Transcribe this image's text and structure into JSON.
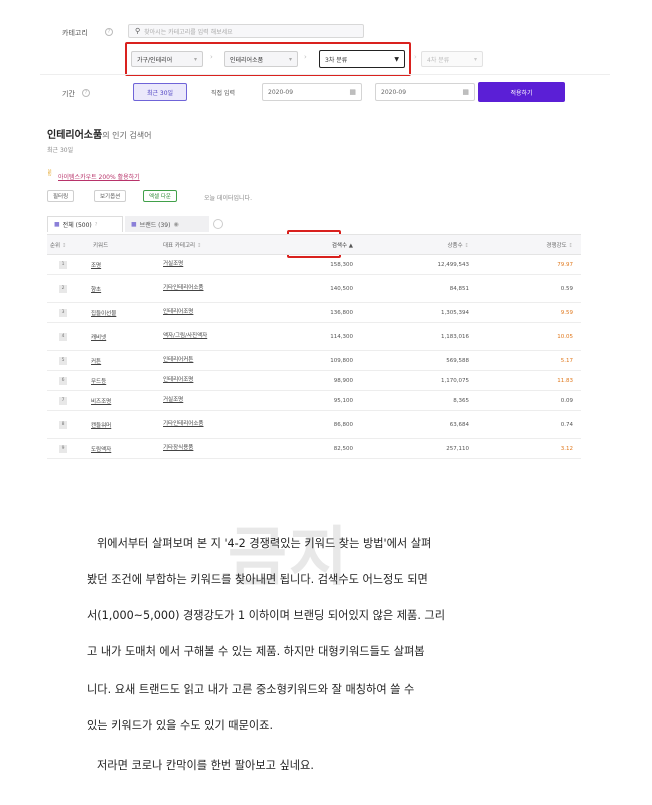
{
  "filters": {
    "category_label": "카테고리",
    "search_placeholder": "찾아시는 카테고리를 입력 해보세요",
    "cat1": "가구/인테리어",
    "cat2": "인테리어소품",
    "cat3": "3차 분류",
    "cat4": "4차 분류",
    "period_label": "기간",
    "recent_30": "최근 30일",
    "direct_input": "직접 입력",
    "start_date": "2020-09",
    "end_date": "2020-09",
    "apply": "적용하기"
  },
  "section": {
    "title_strong": "인테리어소품",
    "title_rest": "의 인기 검색어",
    "subtitle": "최근 30일",
    "promo": "아이템스카우트 200% 활용하기",
    "chips": [
      "필터링",
      "보기옵션",
      "엑셀 다운"
    ],
    "note": "오늘 데이터입니다.",
    "tab_all": "전체 (500)",
    "tab_brand": "브랜드 (39)"
  },
  "table": {
    "headers": [
      "순위",
      "키워드",
      "대표 카테고리",
      "검색수",
      "상품수",
      "경쟁강도"
    ],
    "rows": [
      {
        "rank": "1",
        "keyword": "조명",
        "category": "거실조명",
        "searches": "158,300",
        "products": "12,499,543",
        "comp": "79.97",
        "comp_color": "#e0781c"
      },
      {
        "rank": "2",
        "keyword": "향초",
        "category": "기타인테리어소품",
        "searches": "140,500",
        "products": "84,851",
        "comp": "0.59",
        "comp_color": "#555555"
      },
      {
        "rank": "3",
        "keyword": "집들이선물",
        "category": "인테리어조명",
        "searches": "136,800",
        "products": "1,305,394",
        "comp": "9.59",
        "comp_color": "#e0781c"
      },
      {
        "rank": "4",
        "keyword": "캐비넷",
        "category": "액자/그림/사진액자",
        "searches": "114,300",
        "products": "1,183,016",
        "comp": "10.05",
        "comp_color": "#e0781c"
      },
      {
        "rank": "5",
        "keyword": "커튼",
        "category": "인테리어커튼",
        "searches": "109,800",
        "products": "569,588",
        "comp": "5.17",
        "comp_color": "#e0781c"
      },
      {
        "rank": "6",
        "keyword": "무드등",
        "category": "인테리어조명",
        "searches": "98,900",
        "products": "1,170,075",
        "comp": "11.83",
        "comp_color": "#e0781c"
      },
      {
        "rank": "7",
        "keyword": "비즈조명",
        "category": "거실조명",
        "searches": "95,100",
        "products": "8,365",
        "comp": "0.09",
        "comp_color": "#555555"
      },
      {
        "rank": "8",
        "keyword": "캔들워머",
        "category": "기타인테리어소품",
        "searches": "86,800",
        "products": "63,684",
        "comp": "0.74",
        "comp_color": "#555555"
      },
      {
        "rank": "9",
        "keyword": "도림액자",
        "category": "기타장식용품",
        "searches": "82,500",
        "products": "257,110",
        "comp": "3.12",
        "comp_color": "#e0781c"
      }
    ]
  },
  "article": {
    "lines": [
      "위에서부터 살펴보며 본 지 '4-2 경쟁력있는 키워드 찾는 방법'에서 살펴",
      "봤던 조건에 부합하는 키워드를 찾아내면 됩니다. 검색수도 어느정도 되면",
      "서(1,000~5,000) 경쟁강도가 1 이하이며 브랜딩 되어있지 않은 제품. 그리",
      "고 내가 도매처 에서 구해볼 수 있는 제품. 하지만 대형키워드들도 살펴봅",
      "니다. 요새 트랜드도 읽고 내가 고른 중소형키워드와 잘 매칭하여 쓸 수",
      "있는 키워드가 있을 수도 있기 때문이죠.",
      "저라면 코로나 칸막이를 한번 팔아보고 싶네요."
    ],
    "watermark": "금지"
  },
  "colors": {
    "accent": "#5b1fd6",
    "highlight_box": "#d9211e"
  }
}
